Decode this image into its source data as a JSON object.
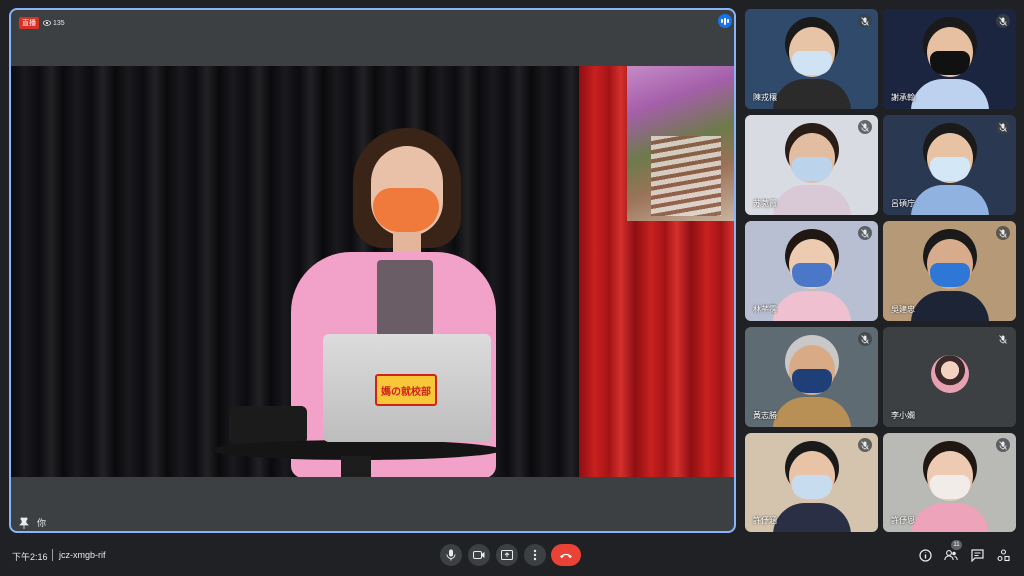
{
  "stage": {
    "live_label": "直播",
    "viewer_count": "135",
    "you_label": "你",
    "sticker_text": "媽の就校部"
  },
  "participants": [
    {
      "name": "陳戎穰",
      "bg": "#2f4a6a",
      "skin": "#e8c4a6",
      "shirt": "#2b2b2b",
      "mask": "#cfe3f5",
      "hair": "#1a1a1a"
    },
    {
      "name": "謝承翰",
      "bg": "#1c2540",
      "skin": "#e6c0a0",
      "shirt": "#bcd2ee",
      "mask": "#111111",
      "hair": "#1a1a1a"
    },
    {
      "name": "苏菀霞",
      "bg": "#d9dbe2",
      "skin": "#e2bda1",
      "shirt": "#d9c9d6",
      "mask": "#bcd3ec",
      "hair": "#2a1d17"
    },
    {
      "name": "呂碩庁",
      "bg": "#2a3852",
      "skin": "#e8c3a3",
      "shirt": "#8fb2e0",
      "mask": "#d4e7f6",
      "hair": "#1a1a1a"
    },
    {
      "name": "林芊霈",
      "bg": "#b9bfd3",
      "skin": "#edcbb0",
      "shirt": "#efc0cf",
      "mask": "#4b77c8",
      "hair": "#201712"
    },
    {
      "name": "吳建忠",
      "bg": "#b69a77",
      "skin": "#d7ab8b",
      "shirt": "#1d2436",
      "mask": "#2f77d6",
      "hair": "#1a1a1a"
    },
    {
      "name": "黃志勝",
      "bg": "#5f6b73",
      "skin": "#d9aa86",
      "shirt": "#b88f55",
      "mask": "#1e3f77",
      "hair": "#c8c8c8"
    },
    {
      "name": "李小嫻",
      "bg": "#3c4043",
      "skin": "",
      "shirt": "",
      "mask": "",
      "hair": ""
    },
    {
      "name": "許伃涵",
      "bg": "#d4c3ad",
      "skin": "#e8c3a6",
      "shirt": "#2a2f45",
      "mask": "#c8dcef",
      "hair": "#1a1a1a"
    },
    {
      "name": "許伃恩",
      "bg": "#b9b9b6",
      "skin": "#edcab1",
      "shirt": "#eda4ba",
      "mask": "#f2ece9",
      "hair": "#201712"
    }
  ],
  "toolbar": {
    "time": "下午2:16",
    "meeting_code": "jcz-xmgb-rif",
    "people_count": "11"
  },
  "icons": [
    "mic-icon",
    "camera-icon",
    "present-icon",
    "more-icon",
    "end-call-icon",
    "info-icon",
    "people-icon",
    "chat-icon",
    "activities-icon"
  ]
}
